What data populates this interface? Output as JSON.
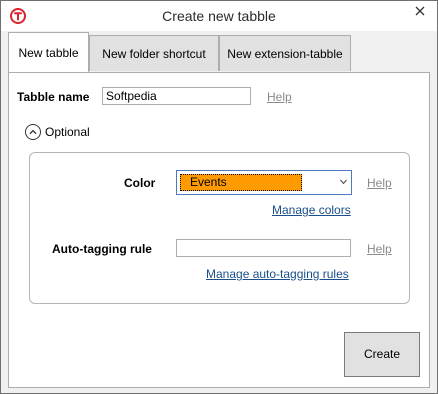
{
  "window": {
    "title": "Create new tabble",
    "app_icon": "tabbles-logo-icon",
    "close_icon": "close-icon",
    "accent_color": "#d9262c"
  },
  "tabs": [
    {
      "label": "New tabble",
      "active": true
    },
    {
      "label": "New folder shortcut",
      "active": false
    },
    {
      "label": "New extension-tabble",
      "active": false
    }
  ],
  "form": {
    "tabble_name_label": "Tabble name",
    "tabble_name_value": "Softpedia",
    "help_link_1": "Help",
    "optional_label": "Optional",
    "optional_icon": "chevron-up-circle-icon",
    "color_label": "Color",
    "color_value": "Events",
    "color_swatch": "#ff9a00",
    "help_link_2": "Help",
    "manage_colors_link": "Manage colors",
    "auto_tagging_label": "Auto-tagging rule",
    "auto_tagging_value": "",
    "help_link_3": "Help",
    "manage_auto_tagging_link": "Manage auto-tagging rules"
  },
  "create_button": "Create"
}
